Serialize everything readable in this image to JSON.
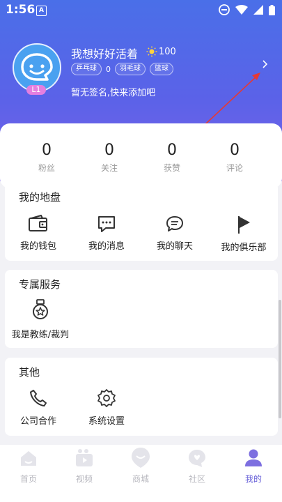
{
  "status": {
    "time": "1:56",
    "badge": "A"
  },
  "profile": {
    "username": "我想好好活着",
    "sun_points": "100",
    "level": "L1",
    "tag_count": "0",
    "tags": [
      "乒乓球",
      "羽毛球",
      "篮球"
    ],
    "signature": "暂无签名,快来添加吧"
  },
  "stats": [
    {
      "value": "0",
      "label": "粉丝"
    },
    {
      "value": "0",
      "label": "关注"
    },
    {
      "value": "0",
      "label": "获赞"
    },
    {
      "value": "0",
      "label": "评论"
    }
  ],
  "sections": {
    "territory": {
      "title": "我的地盘",
      "items": [
        "我的钱包",
        "我的消息",
        "我的聊天",
        "我的俱乐部"
      ]
    },
    "services": {
      "title": "专属服务",
      "items": [
        "我是教练/裁判"
      ]
    },
    "other": {
      "title": "其他",
      "items": [
        "公司合作",
        "系统设置"
      ]
    }
  },
  "tabs": [
    {
      "label": "首页",
      "icon": "home-icon",
      "active": false
    },
    {
      "label": "视频",
      "icon": "video-icon",
      "active": false
    },
    {
      "label": "商城",
      "icon": "mall-icon",
      "active": false
    },
    {
      "label": "社区",
      "icon": "community-icon",
      "active": false
    },
    {
      "label": "我的",
      "icon": "profile-icon",
      "active": true
    }
  ],
  "colors": {
    "header_start": "#4a6fe8",
    "header_end": "#7a63e9",
    "active_tab": "#6a63d9",
    "level_badge": "#e37fe0",
    "annotation_arrow": "#e53935"
  }
}
